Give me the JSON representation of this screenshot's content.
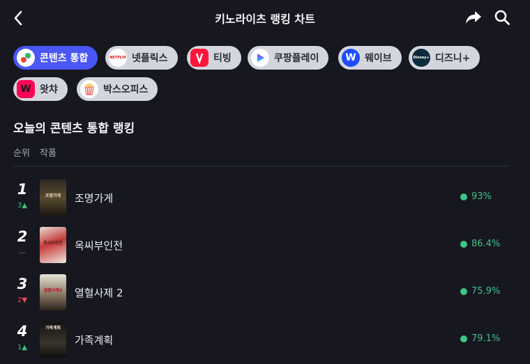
{
  "header": {
    "title": "키노라이츠 랭킹 차트"
  },
  "chips": [
    {
      "label": "콘텐츠 통합",
      "active": true,
      "icon": "combined-logo-icon"
    },
    {
      "label": "넷플릭스",
      "active": false,
      "icon": "netflix-logo-icon",
      "logo_text": "NETFLIX"
    },
    {
      "label": "티빙",
      "active": false,
      "icon": "tving-logo-icon"
    },
    {
      "label": "쿠팡플레이",
      "active": false,
      "icon": "coupangplay-logo-icon"
    },
    {
      "label": "웨이브",
      "active": false,
      "icon": "wavve-logo-icon"
    },
    {
      "label": "디즈니+",
      "active": false,
      "icon": "disneyplus-logo-icon",
      "logo_text": "Disney+"
    },
    {
      "label": "왓챠",
      "active": false,
      "icon": "watcha-logo-icon"
    },
    {
      "label": "박스오피스",
      "active": false,
      "icon": "boxoffice-logo-icon"
    }
  ],
  "section": {
    "title": "오늘의 콘텐츠 통합 랭킹",
    "col_rank": "순위",
    "col_work": "작품"
  },
  "rows": [
    {
      "rank": "1",
      "delta": "3▲",
      "delta_type": "up",
      "title": "조명가게",
      "score": "93%",
      "poster_text": "조명가게"
    },
    {
      "rank": "2",
      "delta": "—",
      "delta_type": "same",
      "title": "옥씨부인전",
      "score": "86.4%",
      "poster_text": "옥씨부인전"
    },
    {
      "rank": "3",
      "delta": "2▼",
      "delta_type": "down",
      "title": "열혈사제 2",
      "score": "75.9%",
      "poster_text": "열혈사제2"
    },
    {
      "rank": "4",
      "delta": "1▲",
      "delta_type": "up",
      "title": "가족계획",
      "score": "79.1%",
      "poster_text": "가족계획"
    }
  ],
  "colors": {
    "background": "#16171f",
    "accent": "#4a56f5",
    "score_green": "#3fc489",
    "up": "#3fbf7f",
    "down": "#f04b5a"
  }
}
